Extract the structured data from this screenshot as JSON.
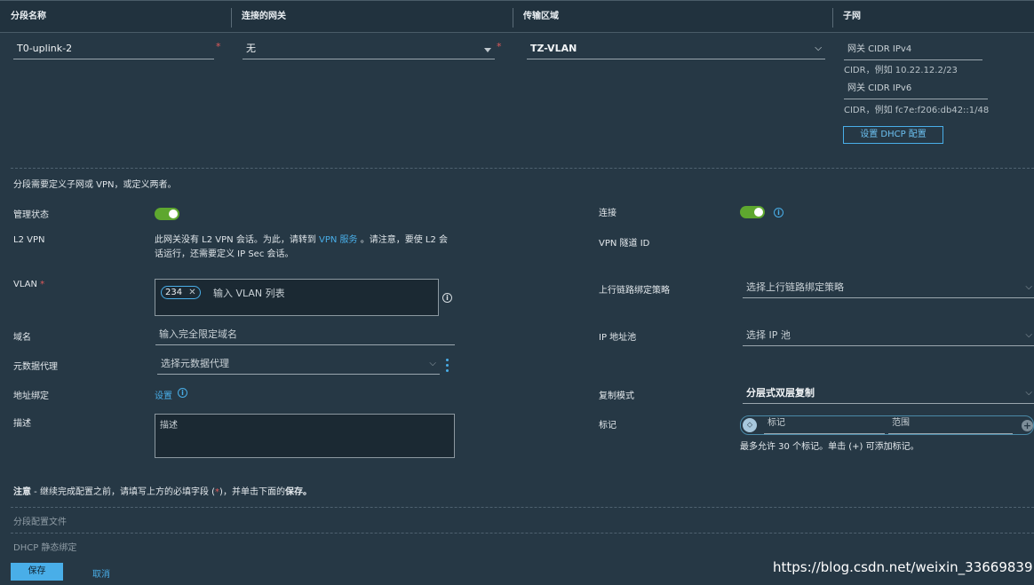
{
  "header": {
    "col1": "分段名称",
    "col2": "连接的网关",
    "col3": "传输区域",
    "col4": "子网"
  },
  "row": {
    "segment_name": "T0-uplink-2",
    "gateway": "无",
    "transport_zone": "TZ-VLAN",
    "ipv4_label": "网关 CIDR IPv4",
    "ipv4_hint": "CIDR，例如 10.22.12.2/23",
    "ipv6_label": "网关 CIDR IPv6",
    "ipv6_hint": "CIDR，例如 fc7e:f206:db42::1/48",
    "dhcp_button": "设置 DHCP 配置",
    "required_mark": "*"
  },
  "notice": "分段需要定义子网或 VPN，或定义两者。",
  "left": {
    "admin_state_label": "管理状态",
    "l2vpn_label": "L2 VPN",
    "l2vpn_text_1": "此网关没有 L2 VPN 会话。为此，请转到",
    "l2vpn_link": "VPN 服务",
    "l2vpn_text_2": "。请注意，要使 L2 会",
    "l2vpn_text_3": "话运行，还需要定义 IP Sec 会话。",
    "vlan_label": "VLAN",
    "vlan_tag": "234",
    "vlan_placeholder": "输入 VLAN 列表",
    "domain_label": "域名",
    "domain_placeholder": "输入完全限定域名",
    "metadata_label": "元数据代理",
    "metadata_placeholder": "选择元数据代理",
    "addr_binding_label": "地址绑定",
    "addr_binding_link": "设置",
    "desc_label": "描述",
    "desc_placeholder": "描述"
  },
  "right": {
    "connect_label": "连接",
    "vpn_tunnel_label": "VPN 隧道 ID",
    "uplink_policy_label": "上行链路绑定策略",
    "uplink_policy_placeholder": "选择上行链路绑定策略",
    "ip_pool_label": "IP 地址池",
    "ip_pool_placeholder": "选择 IP 池",
    "replication_label": "复制模式",
    "replication_value": "分层式双层复制",
    "tags_label": "标记",
    "tag_placeholder": "标记",
    "scope_placeholder": "范围",
    "tags_hint": "最多允许 30 个标记。单击 (+) 可添加标记。"
  },
  "footer_note": {
    "prefix": "注意",
    "text": " - 继续完成配置之前，请填写上方的必填字段 (",
    "star": "*",
    "text2": ")，并单击下面的",
    "bold_end": "保存。"
  },
  "sections": {
    "profiles": "分段配置文件",
    "dhcp_static": "DHCP 静态绑定"
  },
  "buttons": {
    "save": "保存",
    "cancel": "取消"
  },
  "watermark": "https://blog.csdn.net/weixin_33669839",
  "colors": {
    "background": "#263845",
    "accent": "#49aee8",
    "toggle_on": "#5ea72f",
    "required": "#e05a5a"
  },
  "icons": {
    "dropdown": "caret-down-icon",
    "info": "info-circle-icon",
    "tag": "tag-icon",
    "add": "plus-circle-icon",
    "remove": "close-icon",
    "menu": "vertical-dots-icon"
  }
}
